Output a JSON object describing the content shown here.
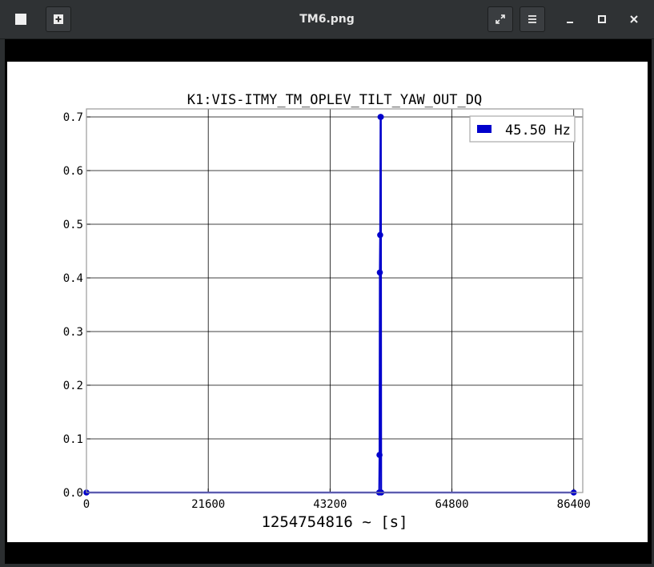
{
  "window": {
    "title": "TM6.png",
    "buttons": {
      "menu_icon": "window-icon",
      "new_icon": "plus-box-icon",
      "fullscreen_icon": "expand-icon",
      "hamburger_icon": "hamburger-icon",
      "minimize_icon": "minimize-icon",
      "maximize_icon": "maximize-icon",
      "close_icon": "close-icon"
    }
  },
  "chart_data": {
    "type": "line",
    "title": "K1:VIS-ITMY_TM_OPLEV_TILT_YAW_OUT_DQ",
    "xlabel": "1254754816 ~ [s]",
    "ylabel": "",
    "xlim": [
      0,
      88000
    ],
    "ylim": [
      0,
      0.7
    ],
    "xticks": [
      0,
      21600,
      43200,
      64800,
      86400
    ],
    "xtick_labels": [
      "0",
      "21600",
      "43200",
      "64800",
      "86400"
    ],
    "yticks": [
      0,
      0.1,
      0.2,
      0.3,
      0.4,
      0.5,
      0.6,
      0.7
    ],
    "ytick_labels": [
      "0.0",
      "0.1",
      "0.2",
      "0.3",
      "0.4",
      "0.5",
      "0.6",
      "0.7"
    ],
    "grid": true,
    "legend": "top-right",
    "series": [
      {
        "name": "45.50 Hz",
        "color": "#0000cc",
        "x": [
          0,
          51900,
          51960,
          52020,
          52080,
          52140,
          52200,
          52260,
          86400
        ],
        "y": [
          0,
          0,
          0.07,
          0.41,
          0.48,
          0.7,
          0.7,
          0,
          0
        ]
      }
    ]
  }
}
